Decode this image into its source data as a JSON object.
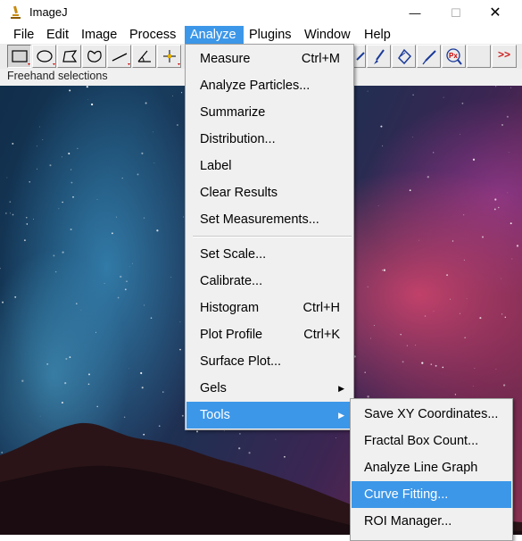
{
  "window": {
    "title": "ImageJ",
    "minimize_glyph": "—",
    "maximize_glyph": "☐",
    "close_glyph": "✕"
  },
  "menubar": [
    {
      "label": "File"
    },
    {
      "label": "Edit"
    },
    {
      "label": "Image"
    },
    {
      "label": "Process"
    },
    {
      "label": "Analyze",
      "active": true
    },
    {
      "label": "Plugins"
    },
    {
      "label": "Window"
    },
    {
      "label": "Help"
    }
  ],
  "toolbar": {
    "tools": [
      "rectangle-selection-icon",
      "oval-selection-icon",
      "polygon-selection-icon",
      "freehand-selection-icon",
      "straight-line-icon",
      "angle-tool-icon",
      "point-tool-icon",
      "wand-tool-icon",
      "paintbrush-icon",
      "flood-fill-icon",
      "color-picker-icon",
      "pixel-inspector-icon"
    ],
    "more_label": ">>"
  },
  "status_text": "Freehand selections",
  "analyze_menu": {
    "group1": [
      {
        "label": "Measure",
        "shortcut": "Ctrl+M"
      },
      {
        "label": "Analyze Particles...",
        "shortcut": ""
      },
      {
        "label": "Summarize",
        "shortcut": ""
      },
      {
        "label": "Distribution...",
        "shortcut": ""
      },
      {
        "label": "Label",
        "shortcut": ""
      },
      {
        "label": "Clear Results",
        "shortcut": ""
      },
      {
        "label": "Set Measurements...",
        "shortcut": ""
      }
    ],
    "group2": [
      {
        "label": "Set Scale...",
        "shortcut": ""
      },
      {
        "label": "Calibrate...",
        "shortcut": ""
      },
      {
        "label": "Histogram",
        "shortcut": "Ctrl+H"
      },
      {
        "label": "Plot Profile",
        "shortcut": "Ctrl+K"
      },
      {
        "label": "Surface Plot...",
        "shortcut": ""
      },
      {
        "label": "Gels",
        "shortcut": "",
        "submenu": true
      },
      {
        "label": "Tools",
        "shortcut": "",
        "submenu": true,
        "highlighted": true
      }
    ],
    "submenu_arrow": "▶"
  },
  "tools_submenu": [
    {
      "label": "Save XY Coordinates..."
    },
    {
      "label": "Fractal Box Count..."
    },
    {
      "label": "Analyze Line Graph"
    },
    {
      "label": "Curve Fitting...",
      "highlighted": true
    },
    {
      "label": "ROI Manager..."
    }
  ],
  "colors": {
    "highlight": "#3d97e8",
    "menu_bg": "#f0f0f0",
    "more_arrows": "#cc2222"
  }
}
